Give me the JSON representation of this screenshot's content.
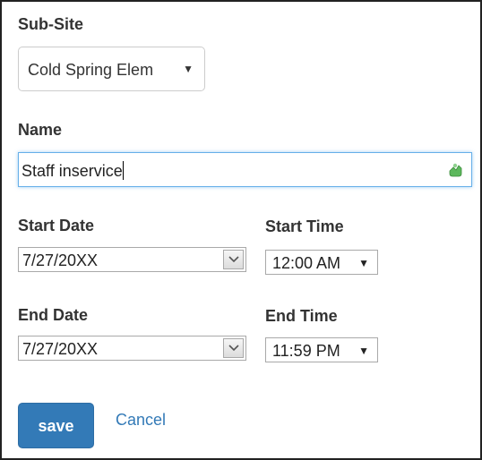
{
  "subsite": {
    "label": "Sub-Site",
    "selected": "Cold Spring Elem"
  },
  "name": {
    "label": "Name",
    "value": "Staff inservice"
  },
  "start_date": {
    "label": "Start Date",
    "value": "7/27/20XX"
  },
  "start_time": {
    "label": "Start Time",
    "value": "12:00 AM"
  },
  "end_date": {
    "label": "End Date",
    "value": "7/27/20XX"
  },
  "end_time": {
    "label": "End Time",
    "value": "11:59 PM"
  },
  "actions": {
    "save_label": "save",
    "cancel_label": "Cancel"
  },
  "icons": {
    "dropdown_caret": "caret-down-icon",
    "autofill": "autofill-icon",
    "date_dropdown": "chevron-down-icon"
  },
  "colors": {
    "primary": "#337ab7",
    "focus_border": "#66afe9",
    "autofill_icon": "#5cb85c"
  }
}
